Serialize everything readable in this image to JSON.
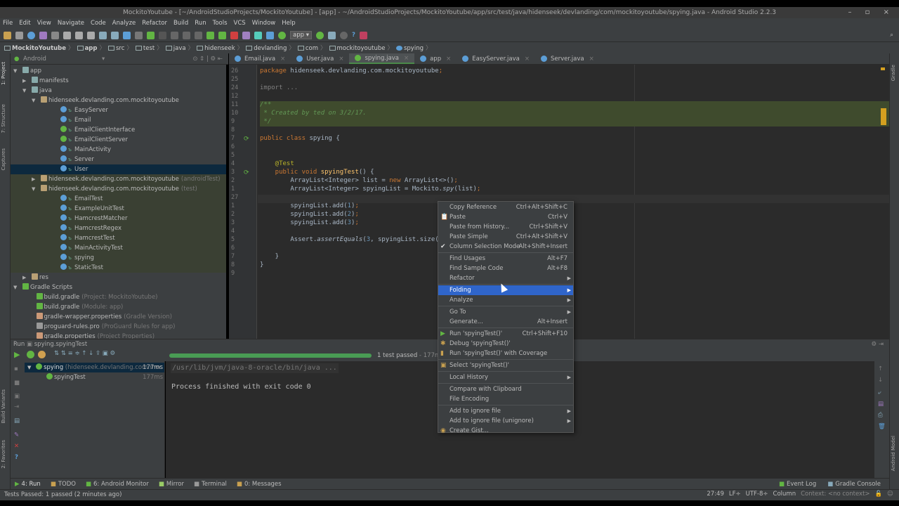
{
  "window": {
    "title": "MockitoYoutube - [~/AndroidStudioProjects/MockitoYoutube] - [app] - ~/AndroidStudioProjects/MockitoYoutube/app/src/test/java/hidenseek/devlanding/com/mockitoyoutube/spying.java - Android Studio 2.2.3",
    "controls": "– ▫ ×"
  },
  "menu": [
    "File",
    "Edit",
    "View",
    "Navigate",
    "Code",
    "Analyze",
    "Refactor",
    "Build",
    "Run",
    "Tools",
    "VCS",
    "Window",
    "Help"
  ],
  "toolbar": {
    "config": "app ▾"
  },
  "breadcrumb": [
    "MockitoYoutube",
    "app",
    "src",
    "test",
    "java",
    "hidenseek",
    "devlanding",
    "com",
    "mockitoyoutube",
    "spying"
  ],
  "left_strip": [
    "1: Project",
    "7: Structure",
    "Captures",
    "Build Variants",
    "2: Favorites"
  ],
  "right_strip": [
    "Gradle",
    "Android Model"
  ],
  "project": {
    "view": "Android",
    "tree": [
      {
        "label": "app",
        "hint": "",
        "depth": 0,
        "arrow": "▼",
        "icon": "#8aa",
        "kind": ""
      },
      {
        "label": "manifests",
        "hint": "",
        "depth": 1,
        "arrow": "▶",
        "icon": "#8aa",
        "kind": ""
      },
      {
        "label": "java",
        "hint": "",
        "depth": 1,
        "arrow": "▼",
        "icon": "#8aa",
        "kind": ""
      },
      {
        "label": "hidenseek.devlanding.com.mockitoyoutube",
        "hint": "",
        "depth": 2,
        "arrow": "▼",
        "icon": "#b9a074",
        "kind": ""
      },
      {
        "label": "EasyServer",
        "hint": "",
        "depth": 3,
        "arrow": "",
        "icon": "#5c9ed6",
        "kind": "cls"
      },
      {
        "label": "Email",
        "hint": "",
        "depth": 3,
        "arrow": "",
        "icon": "#5c9ed6",
        "kind": "cls"
      },
      {
        "label": "EmailClientInterface",
        "hint": "",
        "depth": 3,
        "arrow": "",
        "icon": "#62b543",
        "kind": "cls"
      },
      {
        "label": "EmailClientServer",
        "hint": "",
        "depth": 3,
        "arrow": "",
        "icon": "#62b543",
        "kind": "cls"
      },
      {
        "label": "MainActivity",
        "hint": "",
        "depth": 3,
        "arrow": "",
        "icon": "#5c9ed6",
        "kind": "cls"
      },
      {
        "label": "Server",
        "hint": "",
        "depth": 3,
        "arrow": "",
        "icon": "#5c9ed6",
        "kind": "cls"
      },
      {
        "label": "User",
        "hint": "",
        "depth": 3,
        "arrow": "",
        "icon": "#5c9ed6",
        "kind": "cls",
        "selected": true
      },
      {
        "label": "hidenseek.devlanding.com.mockitoyoutube",
        "hint": "(androidTest)",
        "depth": 2,
        "arrow": "▶",
        "icon": "#b9a074",
        "kind": "",
        "test": true
      },
      {
        "label": "hidenseek.devlanding.com.mockitoyoutube",
        "hint": "(test)",
        "depth": 2,
        "arrow": "▼",
        "icon": "#b9a074",
        "kind": "",
        "test": true
      },
      {
        "label": "EmailTest",
        "hint": "",
        "depth": 3,
        "arrow": "",
        "icon": "#5c9ed6",
        "kind": "cls",
        "test": true
      },
      {
        "label": "ExampleUnitTest",
        "hint": "",
        "depth": 3,
        "arrow": "",
        "icon": "#5c9ed6",
        "kind": "cls",
        "test": true
      },
      {
        "label": "HamcrestMatcher",
        "hint": "",
        "depth": 3,
        "arrow": "",
        "icon": "#5c9ed6",
        "kind": "cls",
        "test": true
      },
      {
        "label": "HamcrestRegex",
        "hint": "",
        "depth": 3,
        "arrow": "",
        "icon": "#5c9ed6",
        "kind": "cls",
        "test": true
      },
      {
        "label": "HamcrestTest",
        "hint": "",
        "depth": 3,
        "arrow": "",
        "icon": "#5c9ed6",
        "kind": "cls",
        "test": true
      },
      {
        "label": "MainActivityTest",
        "hint": "",
        "depth": 3,
        "arrow": "",
        "icon": "#5c9ed6",
        "kind": "cls",
        "test": true
      },
      {
        "label": "spying",
        "hint": "",
        "depth": 3,
        "arrow": "",
        "icon": "#5c9ed6",
        "kind": "cls",
        "test": true
      },
      {
        "label": "StaticTest",
        "hint": "",
        "depth": 3,
        "arrow": "",
        "icon": "#5c9ed6",
        "kind": "cls",
        "test": true
      },
      {
        "label": "res",
        "hint": "",
        "depth": 1,
        "arrow": "▶",
        "icon": "#b9a074",
        "kind": ""
      },
      {
        "label": "Gradle Scripts",
        "hint": "",
        "depth": 0,
        "arrow": "▼",
        "icon": "#62b543",
        "kind": ""
      },
      {
        "label": "build.gradle",
        "hint": "(Project: MockitoYoutube)",
        "depth": 1.5,
        "arrow": "",
        "icon": "#62b543",
        "kind": ""
      },
      {
        "label": "build.gradle",
        "hint": "(Module: app)",
        "depth": 1.5,
        "arrow": "",
        "icon": "#62b543",
        "kind": ""
      },
      {
        "label": "gradle-wrapper.properties",
        "hint": "(Gradle Version)",
        "depth": 1.5,
        "arrow": "",
        "icon": "#c97",
        "kind": ""
      },
      {
        "label": "proguard-rules.pro",
        "hint": "(ProGuard Rules for app)",
        "depth": 1.5,
        "arrow": "",
        "icon": "#999",
        "kind": ""
      },
      {
        "label": "gradle.properties",
        "hint": "(Project Properties)",
        "depth": 1.5,
        "arrow": "",
        "icon": "#c97",
        "kind": ""
      }
    ]
  },
  "tabs": [
    {
      "label": "Email.java",
      "active": false
    },
    {
      "label": "User.java",
      "active": false
    },
    {
      "label": "spying.java",
      "active": true
    },
    {
      "label": "app",
      "active": false
    },
    {
      "label": "EasyServer.java",
      "active": false
    },
    {
      "label": "Server.java",
      "active": false
    }
  ],
  "editor": {
    "lines": [
      {
        "n": "26",
        "t": [
          [
            "package ",
            "kw"
          ],
          [
            "hidenseek.devlanding.com.mockitoyoutube",
            ""
          ],
          [
            ";",
            "kw"
          ]
        ]
      },
      {
        "n": "25",
        "t": []
      },
      {
        "n": "24",
        "t": [
          [
            "import ...",
            "gr"
          ]
        ]
      },
      {
        "n": "12",
        "t": []
      },
      {
        "n": "11",
        "t": [
          [
            "/**",
            "cm"
          ]
        ]
      },
      {
        "n": "10",
        "t": [
          [
            " * Created by ted on 3/2/17.",
            "cm"
          ]
        ]
      },
      {
        "n": "9",
        "t": [
          [
            " */",
            "cm"
          ]
        ]
      },
      {
        "n": "8",
        "t": []
      },
      {
        "n": "7",
        "t": [
          [
            "public class ",
            "kw"
          ],
          [
            "spying {",
            ""
          ]
        ]
      },
      {
        "n": "6",
        "t": []
      },
      {
        "n": "5",
        "t": []
      },
      {
        "n": "4",
        "t": [
          [
            "    @Test",
            "ann"
          ]
        ]
      },
      {
        "n": "3",
        "t": [
          [
            "    public void ",
            "kw"
          ],
          [
            "spyingTest",
            "fn"
          ],
          [
            "() {",
            ""
          ]
        ]
      },
      {
        "n": "2",
        "t": [
          [
            "        ArrayList<Integer> list = ",
            ""
          ],
          [
            "new ",
            "kw"
          ],
          [
            "ArrayList<>()",
            ""
          ],
          [
            ";",
            "kw"
          ]
        ]
      },
      {
        "n": "1",
        "t": [
          [
            "        ArrayList<Integer> spyingList = Mockito.",
            ""
          ],
          [
            "spy",
            "it"
          ],
          [
            "(list)",
            ""
          ],
          [
            ";",
            "kw"
          ]
        ]
      },
      {
        "n": "27",
        "t": []
      },
      {
        "n": "1",
        "t": [
          [
            "        spyingList.add(",
            ""
          ],
          [
            "1",
            "num"
          ],
          [
            ")",
            ""
          ],
          [
            ";",
            "kw"
          ]
        ]
      },
      {
        "n": "2",
        "t": [
          [
            "        spyingList.add(",
            ""
          ],
          [
            "2",
            "num"
          ],
          [
            ")",
            ""
          ],
          [
            ";",
            "kw"
          ]
        ]
      },
      {
        "n": "3",
        "t": [
          [
            "        spyingList.add(",
            ""
          ],
          [
            "3",
            "num"
          ],
          [
            ")",
            ""
          ],
          [
            ";",
            "kw"
          ]
        ]
      },
      {
        "n": "4",
        "t": []
      },
      {
        "n": "5",
        "t": [
          [
            "        Assert.",
            ""
          ],
          [
            "assertEquals",
            "it"
          ],
          [
            "(",
            ""
          ],
          [
            "3",
            "num"
          ],
          [
            ", spyingList.size()",
            ""
          ]
        ]
      },
      {
        "n": "6",
        "t": []
      },
      {
        "n": "7",
        "t": [
          [
            "    }",
            ""
          ]
        ]
      },
      {
        "n": "8",
        "t": [
          [
            "}",
            ""
          ]
        ]
      },
      {
        "n": "9",
        "t": []
      }
    ]
  },
  "run": {
    "header": "Run",
    "config": "spying.spyingTest",
    "status": "1 test passed",
    "time": " - 177ms",
    "progress": 1.0,
    "tests": [
      {
        "label": "spying",
        "hint": " (hidenseek.devlanding.com.moc",
        "time": "177ms"
      },
      {
        "label": "spyingTest",
        "hint": "",
        "time": "177ms"
      }
    ],
    "console": [
      "/usr/lib/jvm/java-8-oracle/bin/java ...",
      "",
      "Process finished with exit code 0"
    ]
  },
  "context_menu": [
    {
      "label": "Copy Reference",
      "shortcut": "Ctrl+Alt+Shift+C"
    },
    {
      "label": "Paste",
      "shortcut": "Ctrl+V",
      "icon": "📋"
    },
    {
      "label": "Paste from History...",
      "shortcut": "Ctrl+Shift+V"
    },
    {
      "label": "Paste Simple",
      "shortcut": "Ctrl+Alt+Shift+V"
    },
    {
      "label": "Column Selection Mode",
      "shortcut": "Alt+Shift+Insert",
      "icon": "✔"
    },
    {
      "sep": true
    },
    {
      "label": "Find Usages",
      "shortcut": "Alt+F7"
    },
    {
      "label": "Find Sample Code",
      "shortcut": "Alt+F8"
    },
    {
      "label": "Refactor",
      "submenu": true
    },
    {
      "sep": true
    },
    {
      "label": "Folding",
      "submenu": true,
      "highlighted": true
    },
    {
      "label": "Analyze",
      "submenu": true
    },
    {
      "sep": true
    },
    {
      "label": "Go To",
      "submenu": true
    },
    {
      "label": "Generate...",
      "shortcut": "Alt+Insert"
    },
    {
      "sep": true
    },
    {
      "label": "Run 'spyingTest()'",
      "shortcut": "Ctrl+Shift+F10",
      "icon": "▶"
    },
    {
      "label": "Debug 'spyingTest()'",
      "icon": "✱"
    },
    {
      "label": "Run 'spyingTest()' with Coverage",
      "icon": "▮"
    },
    {
      "sep": true
    },
    {
      "label": "Select 'spyingTest()'",
      "icon": "▣"
    },
    {
      "sep": true
    },
    {
      "label": "Local History",
      "submenu": true
    },
    {
      "sep": true
    },
    {
      "label": "Compare with Clipboard"
    },
    {
      "label": "File Encoding"
    },
    {
      "sep": true
    },
    {
      "label": "Add to ignore file",
      "submenu": true
    },
    {
      "label": "Add to ignore file (unignore)",
      "submenu": true
    },
    {
      "label": "Create Gist...",
      "icon": "◉"
    }
  ],
  "bottom_tabs": [
    "4: Run",
    "TODO",
    "6: Android Monitor",
    "Mirror",
    "Terminal",
    "0: Messages"
  ],
  "bottom_right": [
    "Event Log",
    "Gradle Console"
  ],
  "status": {
    "message": "Tests Passed: 1 passed (2 minutes ago)",
    "position": "27:49",
    "line_sep": "LF÷",
    "encoding": "UTF-8÷",
    "mode": "Column",
    "context": "Context: <no context>"
  }
}
